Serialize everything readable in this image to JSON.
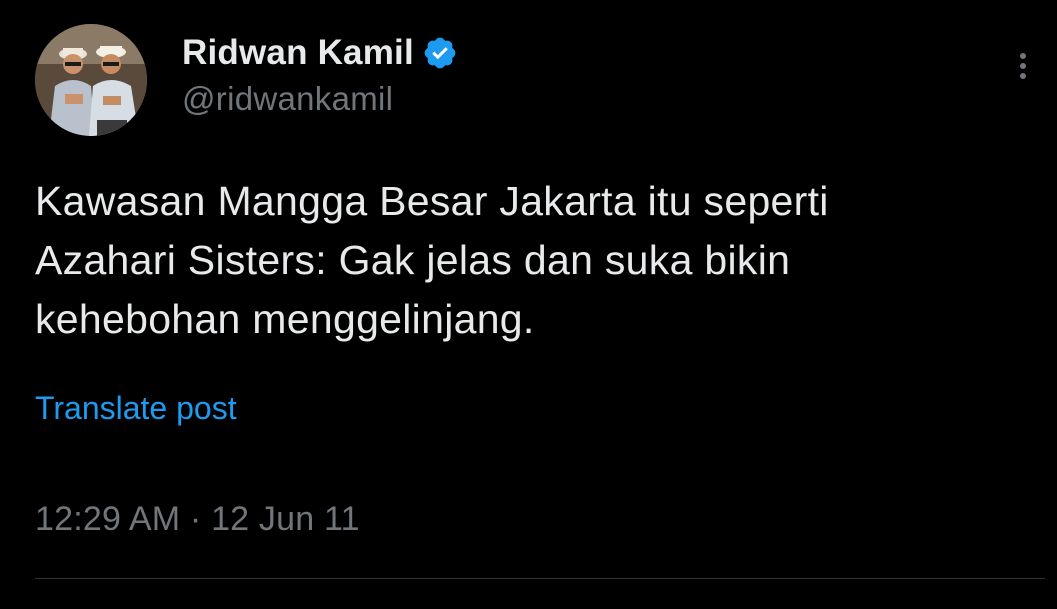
{
  "author": {
    "display_name": "Ridwan Kamil",
    "handle": "@ridwankamil",
    "verified": true,
    "verified_color": "#1d9bf0"
  },
  "post": {
    "text_lines": [
      "Kawasan Mangga Besar Jakarta itu seperti",
      "Azahari Sisters: Gak jelas dan suka bikin",
      "kehebohan menggelinjang."
    ],
    "translate_label": "Translate post",
    "timestamp": "12:29 AM · 12 Jun 11"
  },
  "icons": {
    "more": "more-vertical-icon",
    "verified": "verified-badge-icon"
  },
  "theme": {
    "background": "#000000",
    "text": "#e7e9ea",
    "muted": "#71767b",
    "link": "#1d9bf0"
  }
}
